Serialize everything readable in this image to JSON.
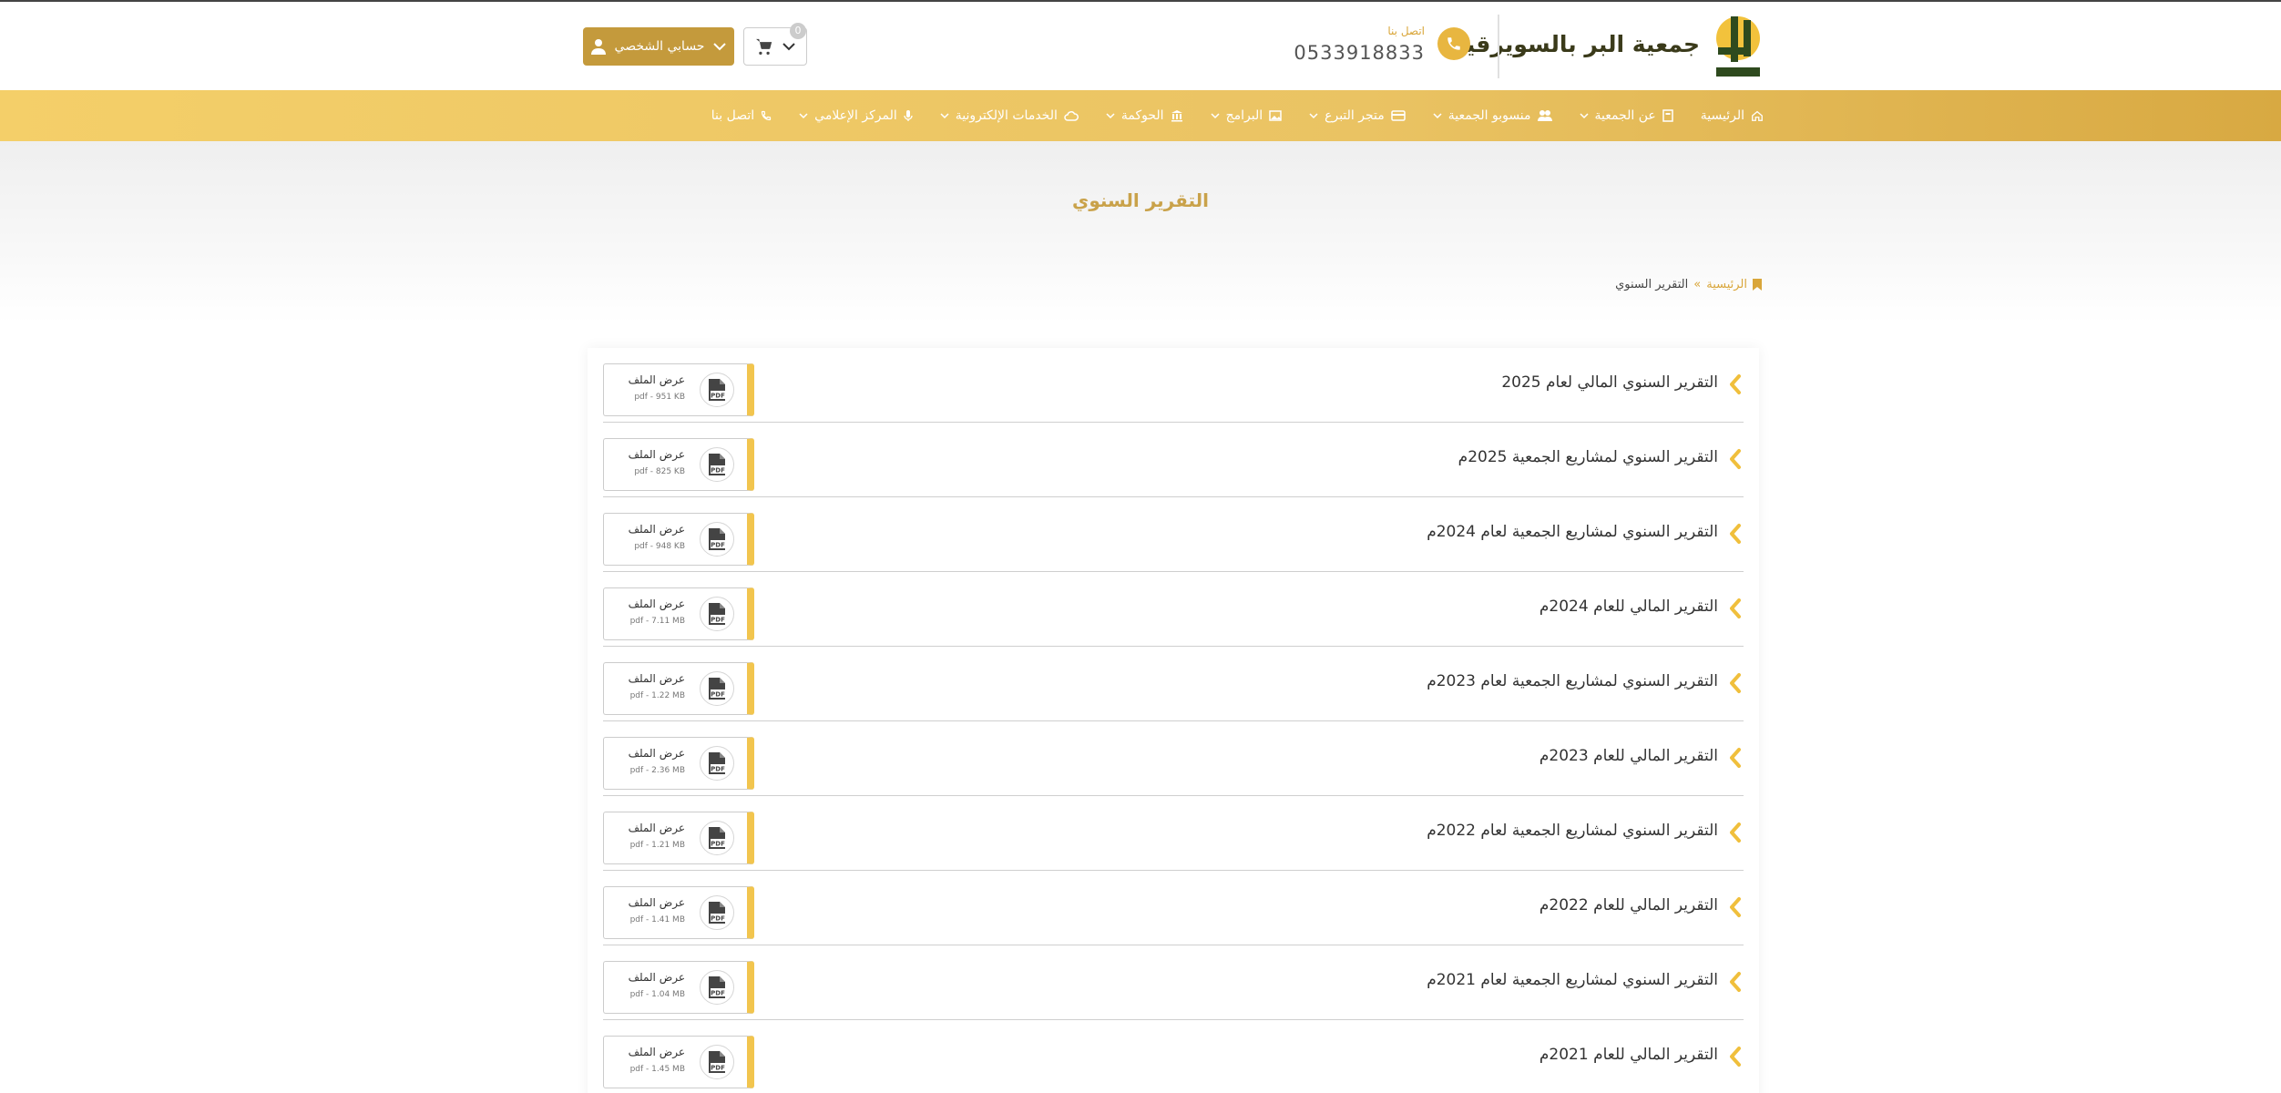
{
  "header": {
    "org_name": "جمعية البر بالسويرقية",
    "phone_label": "اتصل بنا",
    "phone_number": "0533918833",
    "cart_count": "0",
    "account_label": "حسابي الشخصي"
  },
  "nav": {
    "items": [
      {
        "label": "الرئيسية",
        "icon": "home-icon",
        "dropdown": false
      },
      {
        "label": "عن الجمعية",
        "icon": "building-icon",
        "dropdown": true
      },
      {
        "label": "منسوبو الجمعية",
        "icon": "users-icon",
        "dropdown": true
      },
      {
        "label": "متجر التبرع",
        "icon": "card-icon",
        "dropdown": true
      },
      {
        "label": "البرامج",
        "icon": "image-icon",
        "dropdown": true
      },
      {
        "label": "الحوكمة",
        "icon": "bank-icon",
        "dropdown": true
      },
      {
        "label": "الخدمات الإلكترونية",
        "icon": "cloud-icon",
        "dropdown": true
      },
      {
        "label": "المركز الإعلامي",
        "icon": "mic-icon",
        "dropdown": true
      },
      {
        "label": "اتصل بنا",
        "icon": "phone-icon",
        "dropdown": false
      }
    ]
  },
  "page": {
    "title": "التقرير السنوي"
  },
  "breadcrumb": {
    "home": "الرئيسية",
    "separator": "»",
    "current": "التقرير السنوي"
  },
  "reports": [
    {
      "title": "التقرير السنوي المالي لعام 2025",
      "file_label": "عرض الملف",
      "meta": "pdf - 951 KB"
    },
    {
      "title": "التقرير السنوي لمشاريع الجمعية 2025م",
      "file_label": "عرض الملف",
      "meta": "pdf - 825 KB"
    },
    {
      "title": "التقرير السنوي لمشاريع الجمعية لعام 2024م",
      "file_label": "عرض الملف",
      "meta": "pdf - 948 KB"
    },
    {
      "title": "التقرير المالي للعام 2024م",
      "file_label": "عرض الملف",
      "meta": "pdf - 7.11 MB"
    },
    {
      "title": "التقرير السنوي لمشاريع الجمعية لعام 2023م",
      "file_label": "عرض الملف",
      "meta": "pdf - 1.22 MB"
    },
    {
      "title": "التقرير المالي للعام 2023م",
      "file_label": "عرض الملف",
      "meta": "pdf - 2.36 MB"
    },
    {
      "title": "التقرير السنوي لمشاريع الجمعية لعام 2022م",
      "file_label": "عرض الملف",
      "meta": "pdf - 1.21 MB"
    },
    {
      "title": "التقرير المالي للعام 2022م",
      "file_label": "عرض الملف",
      "meta": "pdf - 1.41 MB"
    },
    {
      "title": "التقرير السنوي لمشاريع الجمعية لعام 2021م",
      "file_label": "عرض الملف",
      "meta": "pdf - 1.04 MB"
    },
    {
      "title": "التقرير المالي للعام 2021م",
      "file_label": "عرض الملف",
      "meta": "pdf - 1.45 MB"
    }
  ],
  "colors": {
    "accent": "#e8b640",
    "nav_gradient_start": "#f4cf69",
    "nav_gradient_end": "#d8a942",
    "account_button": "#c49a3c",
    "title": "#c9a24a"
  }
}
